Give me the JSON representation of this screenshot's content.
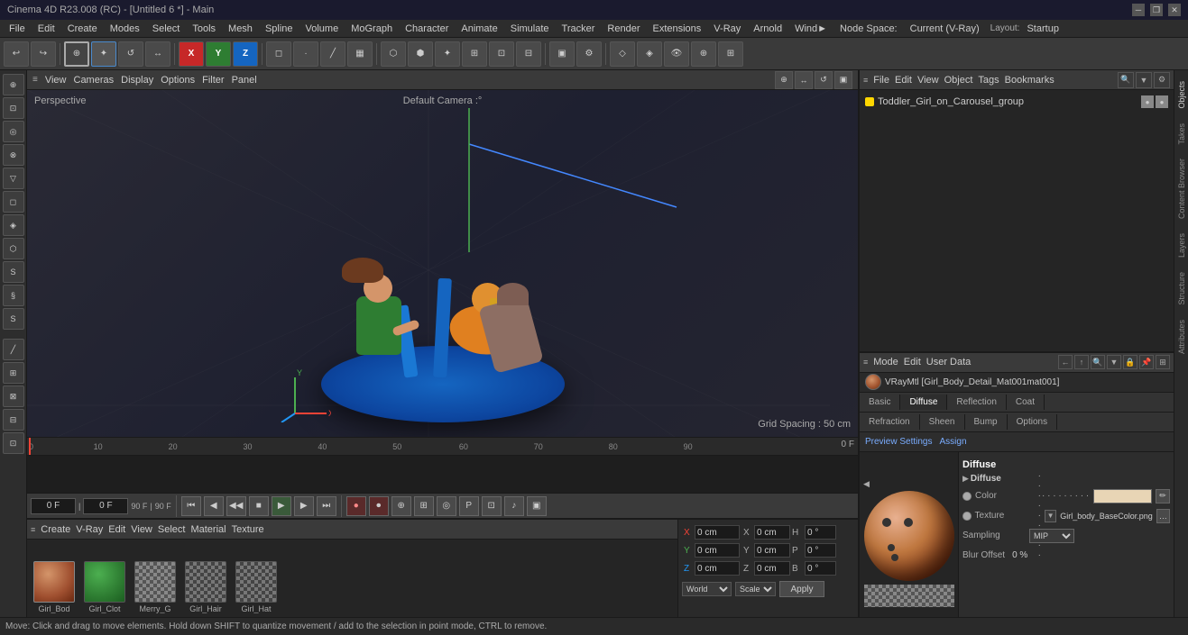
{
  "app": {
    "title": "Cinema 4D R23.008 (RC) - [Untitled 6 *] - Main",
    "mode": "Current (V-Ray)",
    "layout": "Startup",
    "node_space": "Node Space:"
  },
  "title_bar": {
    "title": "Cinema 4D R23.008 (RC) - [Untitled 6 *] - Main"
  },
  "menu": {
    "items": [
      "File",
      "Edit",
      "Create",
      "Modes",
      "Select",
      "Tools",
      "Mesh",
      "Spline",
      "Volume",
      "MoGraph",
      "Character",
      "Animate",
      "Simulate",
      "Tracker",
      "Render",
      "Extensions",
      "V-Ray",
      "Arnold",
      "Wind►",
      "Node Space:",
      "Current (V-Ray)"
    ]
  },
  "viewport": {
    "label": "Perspective",
    "camera": "Default Camera :°",
    "grid_spacing": "Grid Spacing : 50 cm",
    "menus": [
      "View",
      "Cameras",
      "Display",
      "Options",
      "Filter",
      "Panel"
    ]
  },
  "timeline": {
    "current_frame": "0 F",
    "end_frame": "90 F",
    "fps": "90 F",
    "frame_input1": "0 F",
    "frame_input2": "0 F",
    "markers": [
      "0",
      "10",
      "20",
      "30",
      "40",
      "50",
      "60",
      "70",
      "80",
      "90"
    ],
    "marker_positions": [
      0,
      10,
      20,
      30,
      40,
      50,
      60,
      70,
      80,
      90
    ]
  },
  "playback": {
    "buttons": [
      "⏮",
      "⏭",
      "◀",
      "▶",
      "⏹",
      "▶▶",
      "⏭"
    ]
  },
  "materials": {
    "toolbar": [
      "Create",
      "V-Ray",
      "Edit",
      "View",
      "Select",
      "Material",
      "Texture"
    ],
    "items": [
      {
        "name": "Girl_Bod",
        "type": "skin"
      },
      {
        "name": "Girl_Clot",
        "type": "green"
      },
      {
        "name": "Merry_G",
        "type": "checker"
      },
      {
        "name": "Girl_Hair",
        "type": "checker"
      },
      {
        "name": "Girl_Hat",
        "type": "checker"
      }
    ]
  },
  "objects": {
    "toolbar": [
      "File",
      "Edit",
      "View",
      "Object",
      "Tags",
      "Bookmarks"
    ],
    "items": [
      {
        "name": "Toddler_Girl_on_Carousel_group",
        "color": "#ffd700"
      }
    ]
  },
  "attributes": {
    "toolbar": [
      "Mode",
      "Edit",
      "User Data"
    ],
    "material_name": "VRayMtl [Girl_Body_Detail_Mat001mat001]",
    "tabs1": [
      "Basic",
      "Diffuse",
      "Reflection",
      "Coat"
    ],
    "tabs2": [
      "Refraction",
      "Sheen",
      "Bump",
      "Options"
    ],
    "active_tab": "Diffuse",
    "preview_settings": "Preview Settings",
    "assign": "Assign",
    "section_title": "Diffuse",
    "sub_section": "Diffuse",
    "properties": {
      "color_label": "Color",
      "color_dots": "· · · · · · · · ·",
      "texture_label": "Texture",
      "texture_dots": "· · · · · · · · ·",
      "texture_filename": "Girl_body_BaseColor.png",
      "sampling_label": "Sampling",
      "sampling_value": "MIP",
      "blur_label": "Blur Offset",
      "blur_value": "0 %"
    }
  },
  "coordinates": {
    "rows": [
      {
        "label": "X",
        "val1": "0 cm",
        "label2": "X",
        "val2": "0 cm",
        "label3": "H",
        "val3": "0 °"
      },
      {
        "label": "Y",
        "val1": "0 cm",
        "label2": "Y",
        "val2": "0 cm",
        "label3": "P",
        "val3": "0 °"
      },
      {
        "label": "Z",
        "val1": "0 cm",
        "label2": "Z",
        "val2": "0 cm",
        "label3": "B",
        "val3": "0 °"
      }
    ],
    "world": "World",
    "scale": "Scale",
    "apply": "Apply"
  },
  "status_bar": {
    "text": "Move: Click and drag to move elements. Hold down SHIFT to quantize movement / add to the selection in point mode, CTRL to remove."
  },
  "sidebar_tabs": [
    "Objects",
    "Takes",
    "Content Browser",
    "Layers",
    "Structure",
    "Attributes"
  ]
}
